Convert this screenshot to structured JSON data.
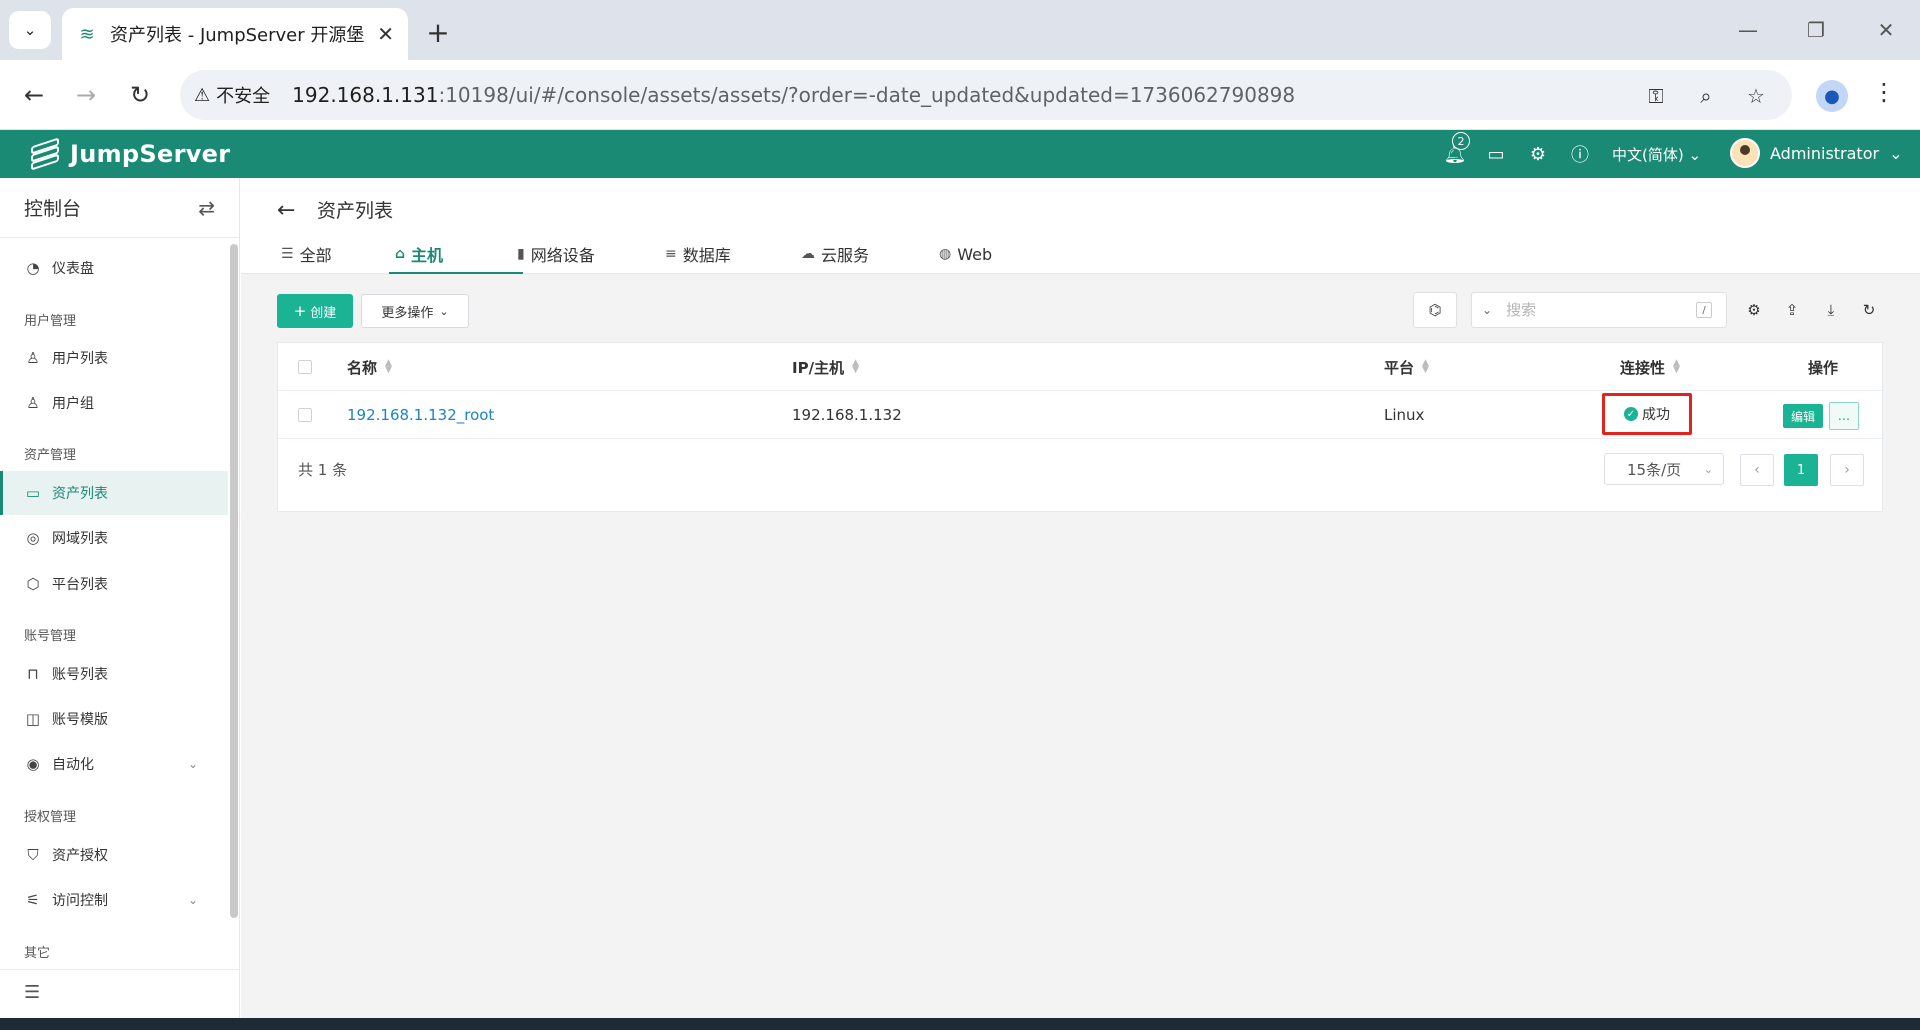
{
  "browser": {
    "tab_title": "资产列表 - JumpServer 开源堡",
    "insecure_label": "不安全",
    "url_host": "192.168.1.131",
    "url_rest": ":10198/ui/#/console/assets/assets/?order=-date_updated&updated=1736062790898"
  },
  "header": {
    "brand": "JumpServer",
    "notification_count": "2",
    "language": "中文(简体)",
    "username": "Administrator"
  },
  "sidebar": {
    "title": "控制台",
    "items": [
      {
        "label": "仪表盘"
      },
      {
        "label": "用户列表"
      },
      {
        "label": "用户组"
      },
      {
        "label": "资产列表"
      },
      {
        "label": "网域列表"
      },
      {
        "label": "平台列表"
      },
      {
        "label": "账号列表"
      },
      {
        "label": "账号模版"
      },
      {
        "label": "自动化"
      },
      {
        "label": "资产授权"
      },
      {
        "label": "访问控制"
      }
    ],
    "groups": [
      "用户管理",
      "资产管理",
      "账号管理",
      "授权管理",
      "其它"
    ]
  },
  "page": {
    "title": "资产列表",
    "tabs": [
      {
        "label": "全部"
      },
      {
        "label": "主机"
      },
      {
        "label": "网络设备"
      },
      {
        "label": "数据库"
      },
      {
        "label": "云服务"
      },
      {
        "label": "Web"
      }
    ],
    "active_tab": "主机"
  },
  "toolbar": {
    "create_label": "创建",
    "more_label": "更多操作",
    "search_placeholder": "搜索",
    "search_shortcut": "/"
  },
  "table": {
    "columns": [
      "名称",
      "IP/主机",
      "平台",
      "连接性",
      "操作"
    ],
    "rows": [
      {
        "name": "192.168.1.132_root",
        "ip": "192.168.1.132",
        "platform": "Linux",
        "connectivity": "成功",
        "edit": "编辑",
        "more": "..."
      }
    ]
  },
  "pagination": {
    "total": "共 1 条",
    "page_size": "15条/页",
    "current_page": "1"
  },
  "colors": {
    "brand": "#1a8a74",
    "accent": "#1ab394",
    "link": "#1c84c6",
    "highlight_box": "#e3231c"
  }
}
